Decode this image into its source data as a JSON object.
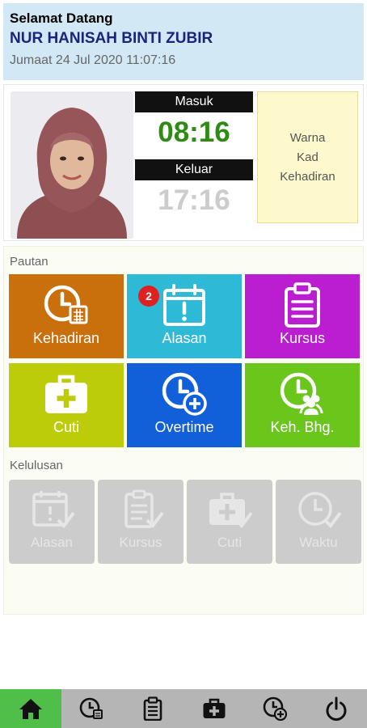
{
  "header": {
    "welcome": "Selamat Datang",
    "user_name": "NUR HANISAH BINTI ZUBIR",
    "datetime": "Jumaat 24 Jul 2020 11:07:16"
  },
  "attendance": {
    "in_label": "Masuk",
    "in_time": "08:16",
    "out_label": "Keluar",
    "out_time": "17:16",
    "colour_card": [
      "Warna",
      "Kad",
      "Kehadiran"
    ]
  },
  "links": {
    "title": "Pautan",
    "tiles": [
      {
        "label": "Kehadiran",
        "icon": "clock-calendar-icon",
        "color": "#c96f0c"
      },
      {
        "label": "Alasan",
        "icon": "calendar-alert-icon",
        "color": "#2ebad6",
        "badge": "2"
      },
      {
        "label": "Kursus",
        "icon": "clipboard-icon",
        "color": "#bb1ed0"
      },
      {
        "label": "Cuti",
        "icon": "medical-kit-icon",
        "color": "#bccc08"
      },
      {
        "label": "Overtime",
        "icon": "clock-plus-icon",
        "color": "#1160d9"
      },
      {
        "label": "Keh. Bhg.",
        "icon": "clock-group-icon",
        "color": "#6ac61a"
      }
    ]
  },
  "approvals": {
    "title": "Kelulusan",
    "tiles": [
      {
        "label": "Alasan",
        "icon": "calendar-check-icon"
      },
      {
        "label": "Kursus",
        "icon": "clipboard-check-icon"
      },
      {
        "label": "Cuti",
        "icon": "medical-kit-check-icon"
      },
      {
        "label": "Waktu",
        "icon": "clock-check-icon"
      }
    ]
  },
  "nav": {
    "items": [
      {
        "icon": "home-icon",
        "active": true
      },
      {
        "icon": "clock-calendar-icon"
      },
      {
        "icon": "clipboard-icon"
      },
      {
        "icon": "medical-kit-icon"
      },
      {
        "icon": "clock-plus-icon"
      },
      {
        "icon": "power-icon"
      }
    ]
  }
}
